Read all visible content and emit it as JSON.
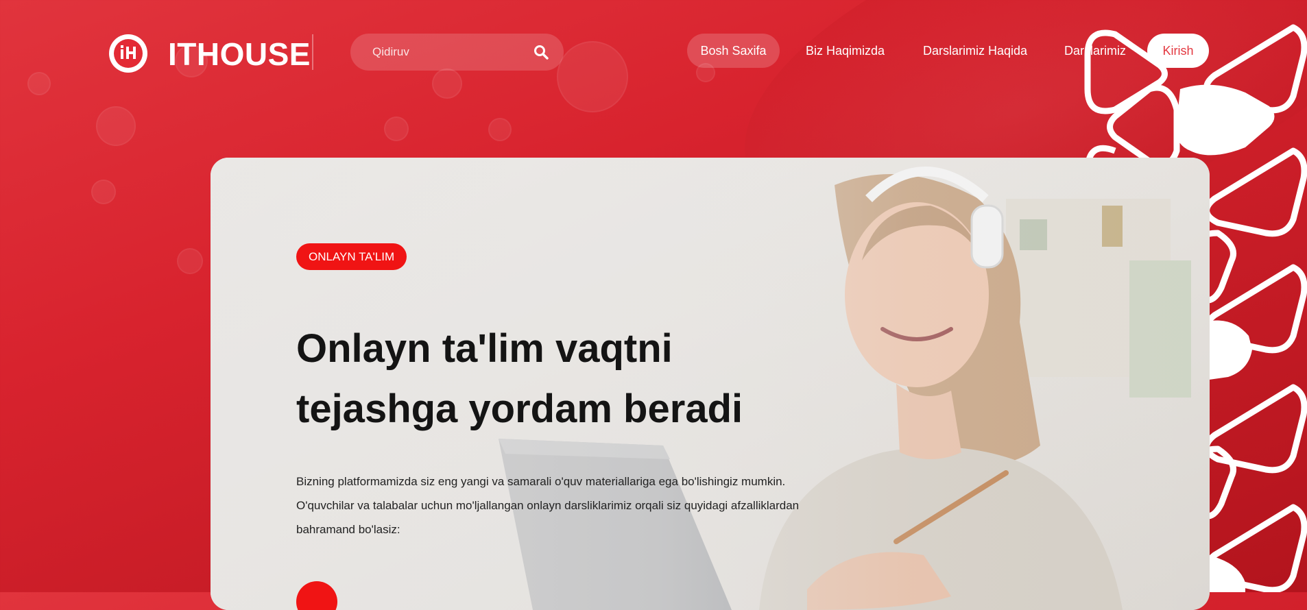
{
  "brand": {
    "name": "ITHOUSE",
    "logo_icon": "ithouse-logo-icon"
  },
  "search": {
    "placeholder": "Qidiruv",
    "icon": "search-icon"
  },
  "nav": {
    "home": "Bosh Saxifa",
    "about": "Biz Haqimizda",
    "lessons_about": "Darslarimiz Haqida",
    "lessons": "Darslarimiz",
    "login": "Kirish"
  },
  "hero": {
    "badge": "ONLAYN TA'LIM",
    "title_line1": "Onlayn ta'lim vaqtni",
    "title_line2": "tejashga yordam beradi",
    "desc_line1": "Bizning platformamizda siz eng yangi va samarali o'quv materiallariga ega bo'lishingiz mumkin.",
    "desc_line2": "O'quvchilar va talabalar uchun mo'ljallangan onlayn darsliklarimiz orqali siz quyidagi afzalliklardan",
    "desc_line3": "bahramand bo'lasiz:"
  },
  "colors": {
    "primary": "#d8232e",
    "accent": "#f01414",
    "card_bg": "#e4e2df",
    "title": "#141414"
  }
}
